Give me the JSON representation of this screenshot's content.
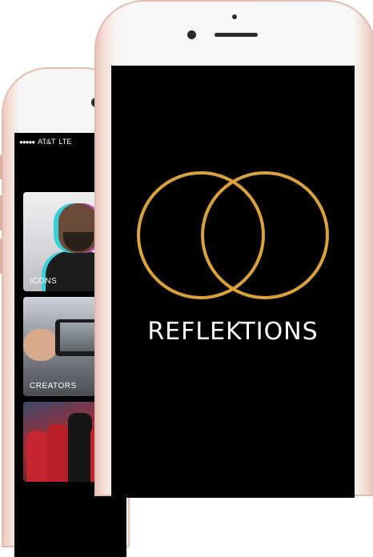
{
  "back_phone": {
    "status_bar": {
      "signal": "●●●●●",
      "carrier": "AT&T",
      "network": "LTE"
    },
    "categories": [
      {
        "label": "ICONS"
      },
      {
        "label": "CREATORS"
      },
      {
        "label": ""
      }
    ]
  },
  "front_phone": {
    "app_title": "REFLEKTIONS",
    "logo_icon": "interlocking-rings-icon"
  },
  "colors": {
    "brand_gold": "#D9A23C",
    "screen_background": "#000000",
    "device_rose_gold": "#E7C2B6"
  }
}
